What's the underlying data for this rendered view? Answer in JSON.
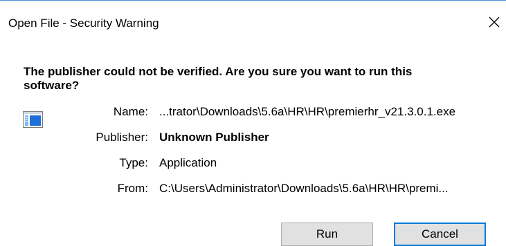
{
  "window": {
    "title": "Open File - Security Warning"
  },
  "heading": "The publisher could not be verified.  Are you sure you want to run this software?",
  "details": {
    "name_label": "Name:",
    "name_value": "...trator\\Downloads\\5.6a\\HR\\HR\\premierhr_v21.3.0.1.exe",
    "publisher_label": "Publisher:",
    "publisher_value": "Unknown Publisher",
    "type_label": "Type:",
    "type_value": "Application",
    "from_label": "From:",
    "from_value": "C:\\Users\\Administrator\\Downloads\\5.6a\\HR\\HR\\premi..."
  },
  "buttons": {
    "run": "Run",
    "cancel": "Cancel"
  },
  "icons": {
    "close": "close-icon",
    "app": "application-icon"
  },
  "colors": {
    "accent": "#0078d7",
    "button_bg": "#e1e1e1"
  }
}
